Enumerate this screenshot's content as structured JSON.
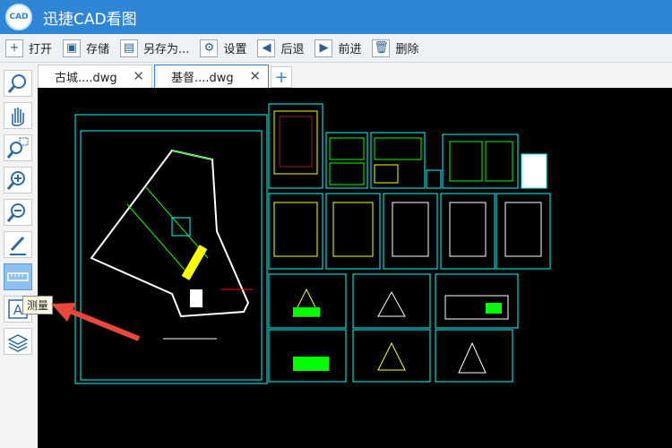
{
  "app": {
    "logo_text": "CAD",
    "title": "迅捷CAD看图"
  },
  "toolbar": {
    "open": "打开",
    "save": "存储",
    "save_as": "另存为...",
    "settings": "设置",
    "back": "后退",
    "forward": "前进",
    "delete": "删除"
  },
  "tabs": [
    {
      "label": "古城....dwg",
      "close": "✕"
    },
    {
      "label": "基督....dwg",
      "close": "✕"
    }
  ],
  "tab_add": "+",
  "tooltip": "测量",
  "colors": {
    "accent": "#2f86d6",
    "canvas": "#000000",
    "cad_line": "#00ffff",
    "arrow": "#e8473a"
  },
  "tools": [
    "zoom-rotate-icon",
    "pan-hand-icon",
    "zoom-window-icon",
    "zoom-in-icon",
    "zoom-out-icon",
    "pen-icon",
    "measure-ruler-icon",
    "text-icon",
    "layers-icon"
  ]
}
